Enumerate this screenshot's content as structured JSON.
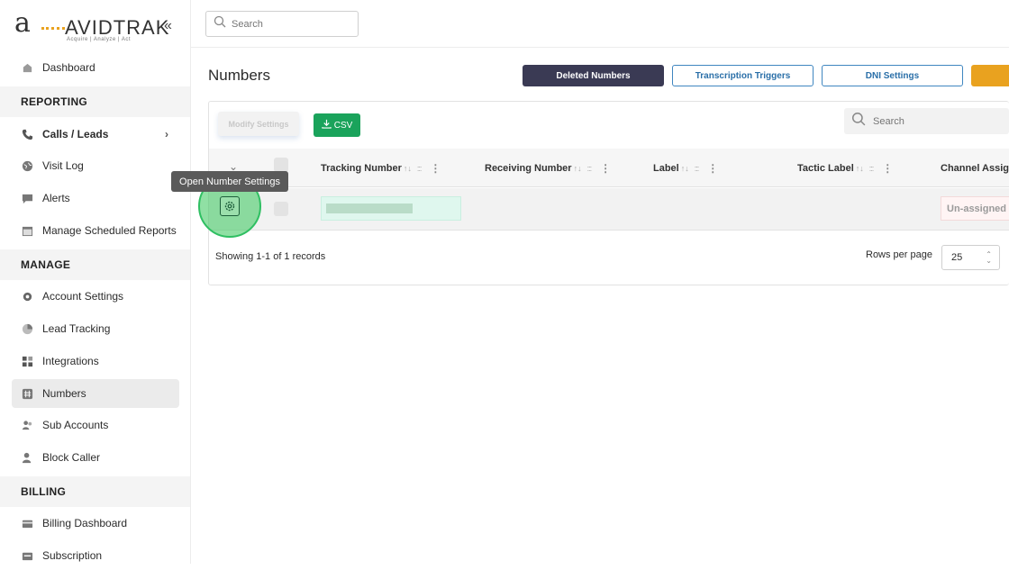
{
  "brand": {
    "logo_letter": "a",
    "name": "AVIDTRAK",
    "tagline": "Acquire  |  Analyze  |  Act",
    "accent": "#e9a21f"
  },
  "sidebar": {
    "collapse_icon": "double-chevron-left-icon",
    "dashboard": "Dashboard",
    "sections": {
      "reporting": "REPORTING",
      "manage": "MANAGE",
      "billing": "BILLING"
    },
    "reporting_items": [
      {
        "label": "Calls / Leads",
        "icon": "phone-icon"
      },
      {
        "label": "Visit Log",
        "icon": "globe-icon"
      },
      {
        "label": "Alerts",
        "icon": "chat-icon"
      },
      {
        "label": "Manage Scheduled Reports",
        "icon": "calendar-icon"
      }
    ],
    "manage_items": [
      {
        "label": "Account Settings",
        "icon": "gear-icon"
      },
      {
        "label": "Lead Tracking",
        "icon": "pie-chart-icon"
      },
      {
        "label": "Integrations",
        "icon": "grid-icon"
      },
      {
        "label": "Numbers",
        "icon": "hash-icon"
      },
      {
        "label": "Sub Accounts",
        "icon": "users-icon"
      },
      {
        "label": "Block Caller",
        "icon": "user-block-icon"
      }
    ],
    "billing_items": [
      {
        "label": "Billing Dashboard",
        "icon": "credit-card-icon"
      },
      {
        "label": "Subscription",
        "icon": "subscription-icon"
      }
    ]
  },
  "topbar": {
    "search_placeholder": "Search"
  },
  "page": {
    "title": "Numbers",
    "buttons": {
      "deleted": "Deleted Numbers",
      "transcription": "Transcription Triggers",
      "dni": "DNI Settings"
    }
  },
  "table": {
    "modify_label": "Modify Settings",
    "csv_label": "CSV",
    "search_placeholder": "Search",
    "columns": [
      "Tracking Number",
      "Receiving Number",
      "Label",
      "Tactic Label",
      "Channel Assig"
    ],
    "row": {
      "channel": "Un-assigned"
    },
    "tooltip": "Open Number Settings",
    "showing": "Showing 1-1 of 1 records",
    "rows_per_page_label": "Rows per page",
    "rows_per_page_value": "25"
  }
}
